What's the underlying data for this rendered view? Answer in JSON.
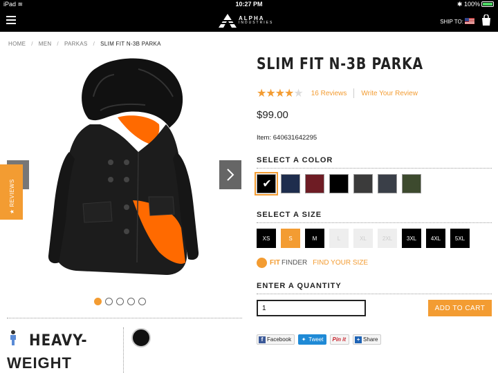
{
  "status_bar": {
    "device": "iPad",
    "time": "10:27 PM",
    "battery": "100%"
  },
  "header": {
    "logo_line1": "ALPHA",
    "logo_line2": "INDUSTRIES",
    "ship_to": "SHIP TO:"
  },
  "breadcrumb": {
    "items": [
      "HOME",
      "MEN",
      "PARKAS"
    ],
    "current": "SLIM FIT N-3B PARKA"
  },
  "gallery": {
    "reviews_tab": "★ REVIEWS",
    "dots": 5,
    "active_dot": 1
  },
  "product": {
    "title": "SLIM FIT N-3B PARKA",
    "rating": 4,
    "rating_max": 5,
    "reviews_link": "16 Reviews",
    "write_review": "Write Your Review",
    "price": "$99.00",
    "item": "Item: 640631642295"
  },
  "color": {
    "label": "SELECT A COLOR",
    "swatches": [
      "#000000",
      "#1e2d4d",
      "#6e1c24",
      "#000000",
      "#3b3b3b",
      "#3a3f48",
      "#3d4a2e"
    ],
    "selected": 0
  },
  "size": {
    "label": "SELECT A SIZE",
    "options": [
      "XS",
      "S",
      "M",
      "L",
      "XL",
      "2XL",
      "3XL",
      "4XL",
      "5XL"
    ],
    "selected": "S",
    "unavailable": [
      "L",
      "XL",
      "2XL"
    ]
  },
  "fit_finder": {
    "fit": "FIT",
    "finder": "FINDER",
    "link": "FIND YOUR SIZE"
  },
  "quantity": {
    "label": "ENTER A QUANTITY",
    "value": "1"
  },
  "cart_button": "ADD TO CART",
  "share": {
    "facebook": "Facebook",
    "tweet": "Tweet",
    "pinit": "Pin it",
    "share": "Share"
  },
  "promo": {
    "line1": "HEAVY-",
    "line2": "WEIGHT"
  },
  "colors": {
    "accent": "#f39c32"
  }
}
